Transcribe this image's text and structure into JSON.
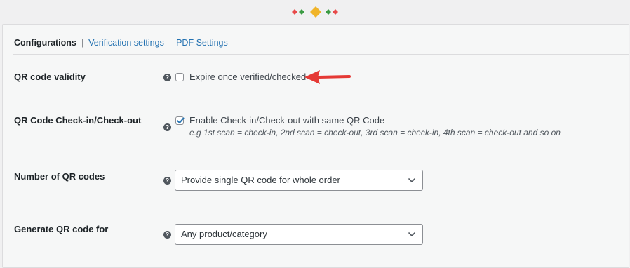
{
  "tabs": {
    "active": "Configurations",
    "separator": "|",
    "verification": "Verification settings",
    "pdf": "PDF Settings"
  },
  "fields": {
    "validity": {
      "label": "QR code validity",
      "help": "?",
      "checkbox_label": "Expire once verified/checked",
      "checked": false
    },
    "checkin": {
      "label": "QR Code Check-in/Check-out",
      "help": "?",
      "checkbox_label": "Enable Check-in/Check-out with same QR Code",
      "hint": "e.g 1st scan = check-in, 2nd scan = check-out, 3rd scan = check-in, 4th scan = check-out and so on",
      "checked": true
    },
    "number": {
      "label": "Number of QR codes",
      "help": "?",
      "selected": "Provide single QR code for whole order"
    },
    "generate": {
      "label": "Generate QR code for",
      "help": "?",
      "selected": "Any product/category"
    }
  },
  "colors": {
    "accent": "#2271b1",
    "arrow": "#e53935",
    "logo_red": "#e84a4a",
    "logo_green": "#3a9b43",
    "logo_gold": "#f0b429"
  },
  "icons": {
    "help": "question-circle-icon",
    "checkmark": "checkmark-icon",
    "dropdown": "chevron-down-icon",
    "annotation": "red-arrow-icon",
    "logo": "diamond-logo-icon"
  }
}
